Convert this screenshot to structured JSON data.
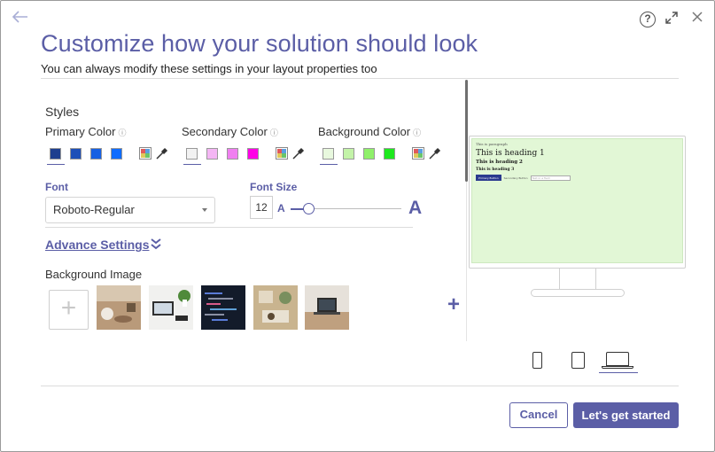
{
  "dialog": {
    "title": "Customize how your solution should look",
    "subtitle": "You can always modify these settings in your layout properties too",
    "help_glyph": "?",
    "icons": [
      "back-arrow-icon",
      "help-icon",
      "expand-icon",
      "close-icon"
    ]
  },
  "styles": {
    "heading": "Styles",
    "info_glyph": "ⓘ",
    "primary": {
      "label": "Primary Color",
      "swatches": [
        "#1e3f8f",
        "#1d4fb8",
        "#1760e3",
        "#0f6cff"
      ],
      "selected_index": 0
    },
    "secondary": {
      "label": "Secondary Color",
      "swatches": [
        "#f2f2f2",
        "#f4b6f4",
        "#f07ff0",
        "#ff00e6"
      ],
      "selected_index": 0
    },
    "background": {
      "label": "Background Color",
      "swatches": [
        "#e8f8de",
        "#c3f3a8",
        "#8ff06a",
        "#1ee81e"
      ],
      "selected_index": 0
    }
  },
  "font": {
    "label": "Font",
    "value": "Roboto-Regular",
    "size_label": "Font Size",
    "size_value": "12",
    "small_a": "A",
    "large_a": "A",
    "slider_level": 0.15
  },
  "advanced": {
    "label": "Advance Settings",
    "chevron": "❯❯"
  },
  "background_image": {
    "label": "Background Image",
    "add_glyph": "+",
    "thumbnails": [
      "coffee-desk-photo",
      "laptop-plant-photo",
      "code-screen-photo",
      "workspace-topdown-photo",
      "laptop-table-photo"
    ]
  },
  "preview": {
    "paragraph": "This is paragraph",
    "heading1": "This is heading 1",
    "heading2": "This is heading 2",
    "heading3": "This is heading 3",
    "primary_button": "Primary Button",
    "secondary_button": "Secondary Button",
    "input_placeholder": "Text in a field",
    "plus_glyph": "+",
    "devices": [
      "phone-icon",
      "tablet-icon",
      "laptop-icon"
    ],
    "selected_device": "laptop-icon"
  },
  "footer": {
    "cancel": "Cancel",
    "start": "Let's get started"
  },
  "colors": {
    "accent": "#5b5ea6"
  }
}
